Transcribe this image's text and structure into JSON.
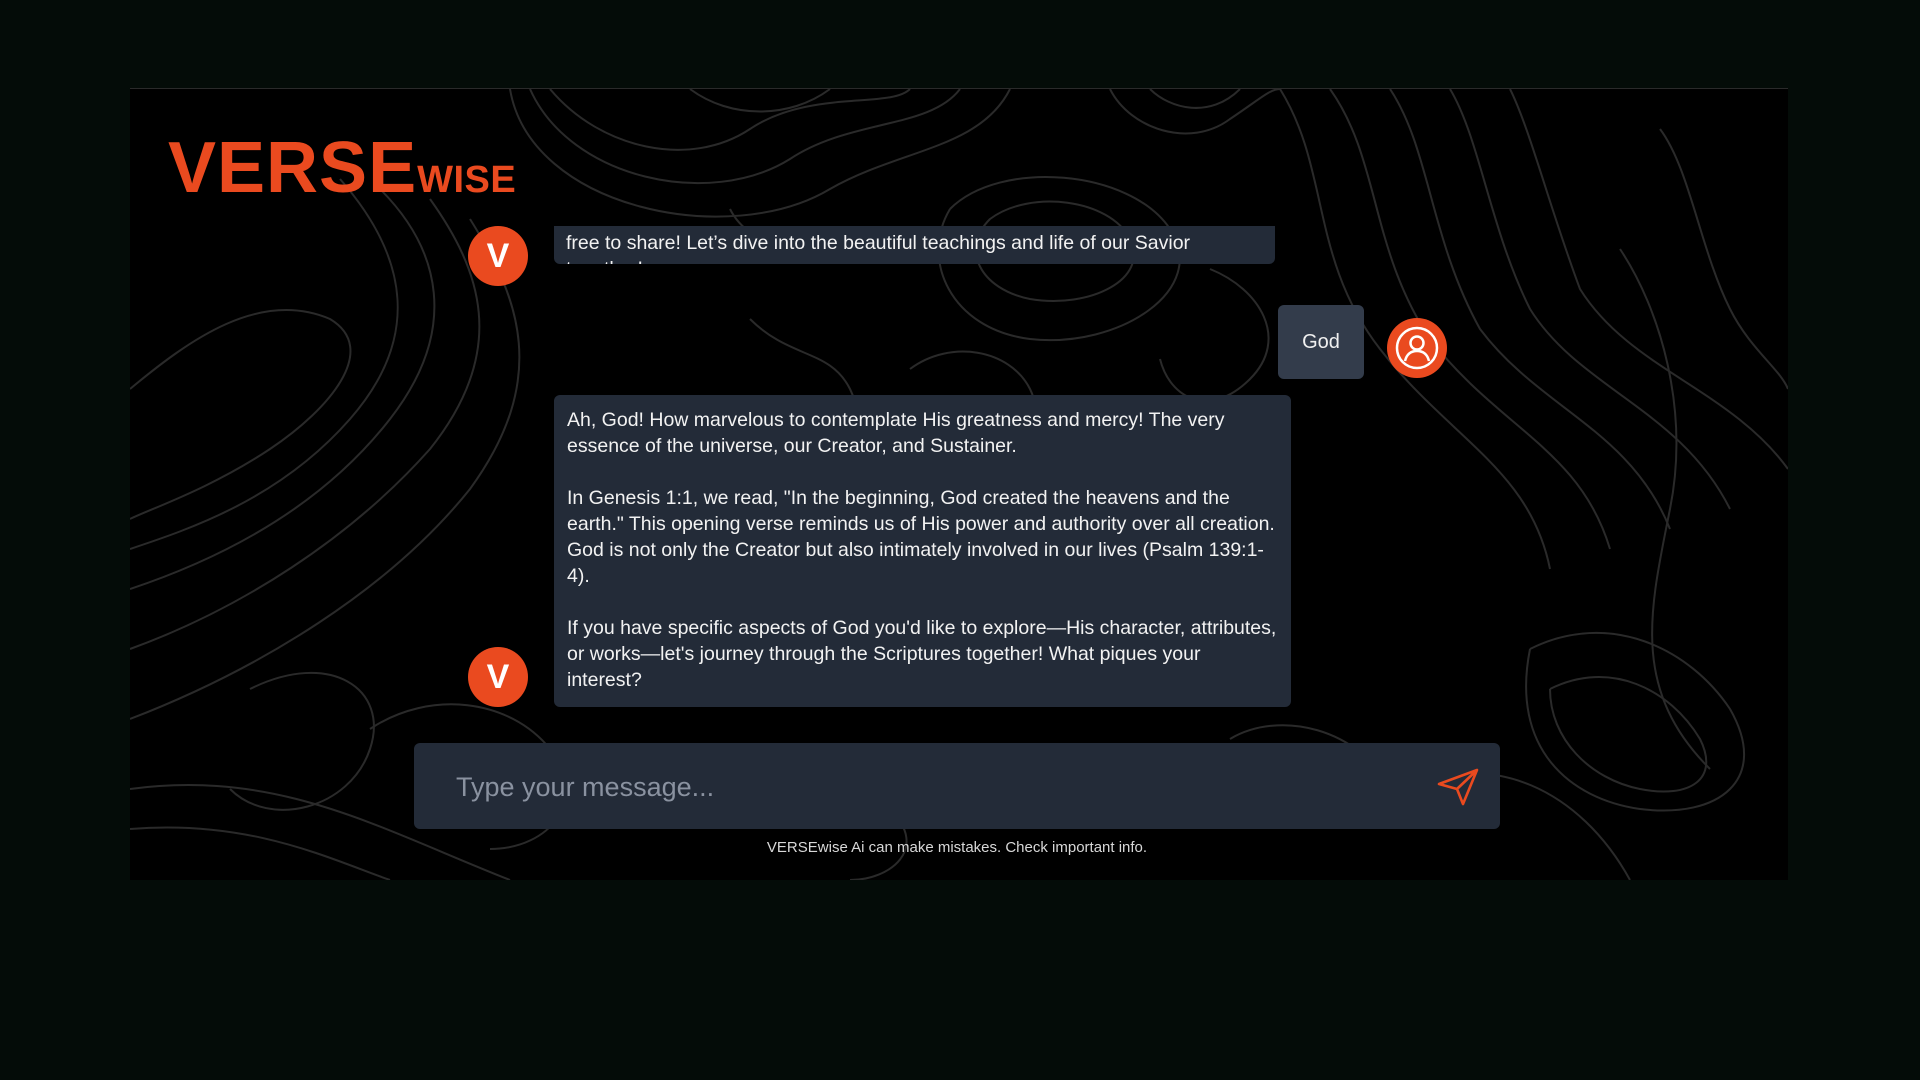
{
  "brand": {
    "big": "VERSE",
    "small": "WISE",
    "color": "#ea4a1f"
  },
  "messages": [
    {
      "role": "assistant",
      "avatar": "V",
      "paragraphs": [
        "free to share! Let’s dive into the beautiful teachings and life of our Savior together!"
      ]
    },
    {
      "role": "user",
      "text": "God",
      "avatar_icon": "user-circle-icon"
    },
    {
      "role": "assistant",
      "avatar": "V",
      "paragraphs": [
        "Ah, God! How marvelous to contemplate His greatness and mercy! The very essence of the universe, our Creator, and Sustainer.",
        "In Genesis 1:1, we read, \"In the beginning, God created the heavens and the earth.\" This opening verse reminds us of His power and authority over all creation. God is not only the Creator but also intimately involved in our lives (Psalm 139:1-4).",
        "If you have specific aspects of God you'd like to explore—His character, attributes, or works—let's journey through the Scriptures together! What piques your interest?"
      ]
    }
  ],
  "composer": {
    "placeholder": "Type your message...",
    "send_icon": "send-icon"
  },
  "disclaimer": "VERSEwise Ai can make mistakes. Check important info."
}
